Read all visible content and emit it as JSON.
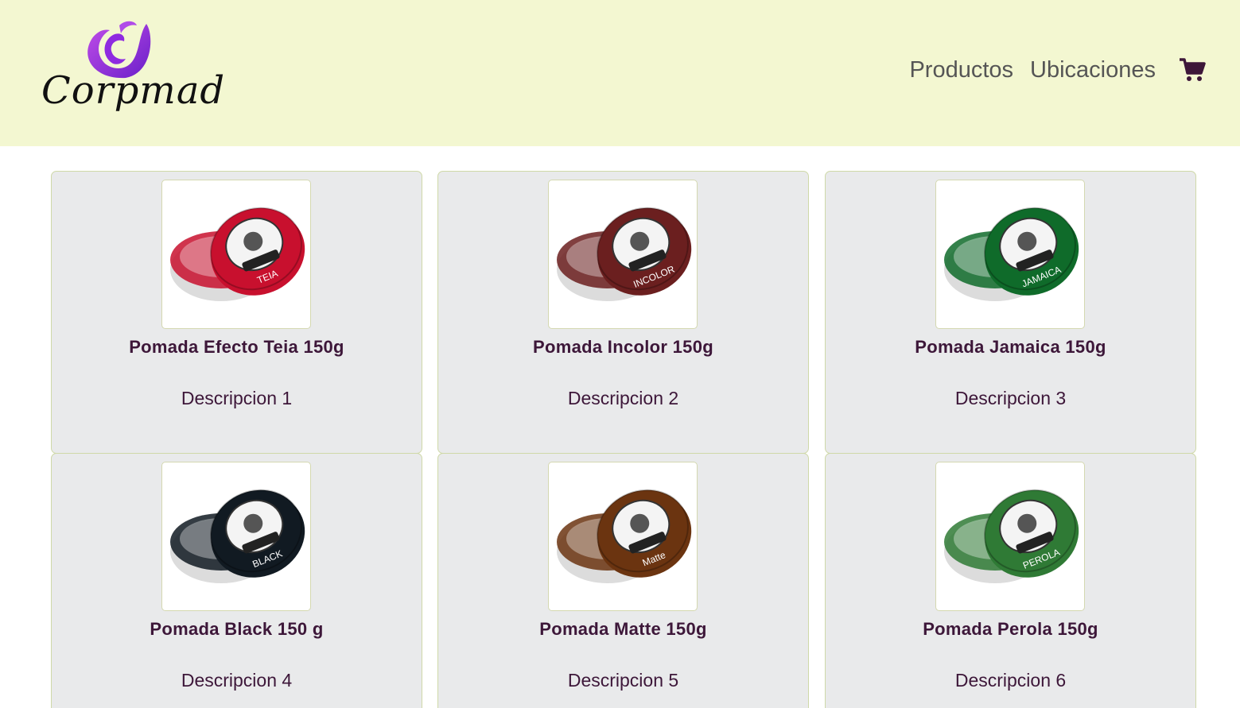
{
  "header": {
    "brand": "Corpmad",
    "nav": [
      {
        "label": "Productos"
      },
      {
        "label": "Ubicaciones"
      }
    ],
    "cart_icon": "shopping-cart-icon",
    "colors": {
      "background": "#f3f7d1",
      "logo_purple": "#9b30e0",
      "cart": "#3d1739"
    }
  },
  "products": [
    {
      "title": "Pomada Efecto Teia 150g",
      "description": "Descripcion 1",
      "color": "#c8102e",
      "jar_label": "TEIA"
    },
    {
      "title": "Pomada Incolor 150g",
      "description": "Descripcion 2",
      "color": "#6b1f1f",
      "jar_label": "INCOLOR"
    },
    {
      "title": "Pomada Jamaica 150g",
      "description": "Descripcion 3",
      "color": "#0f6b2a",
      "jar_label": "JAMAICA"
    },
    {
      "title": "Pomada Black 150 g",
      "description": "Descripcion 4",
      "color": "#111a22",
      "jar_label": "BLACK"
    },
    {
      "title": "Pomada Matte 150g",
      "description": "Descripcion 5",
      "color": "#6b3410",
      "jar_label": "Matte"
    },
    {
      "title": "Pomada Perola 150g",
      "description": "Descripcion 6",
      "color": "#2f7a35",
      "jar_label": "PEROLA"
    }
  ]
}
